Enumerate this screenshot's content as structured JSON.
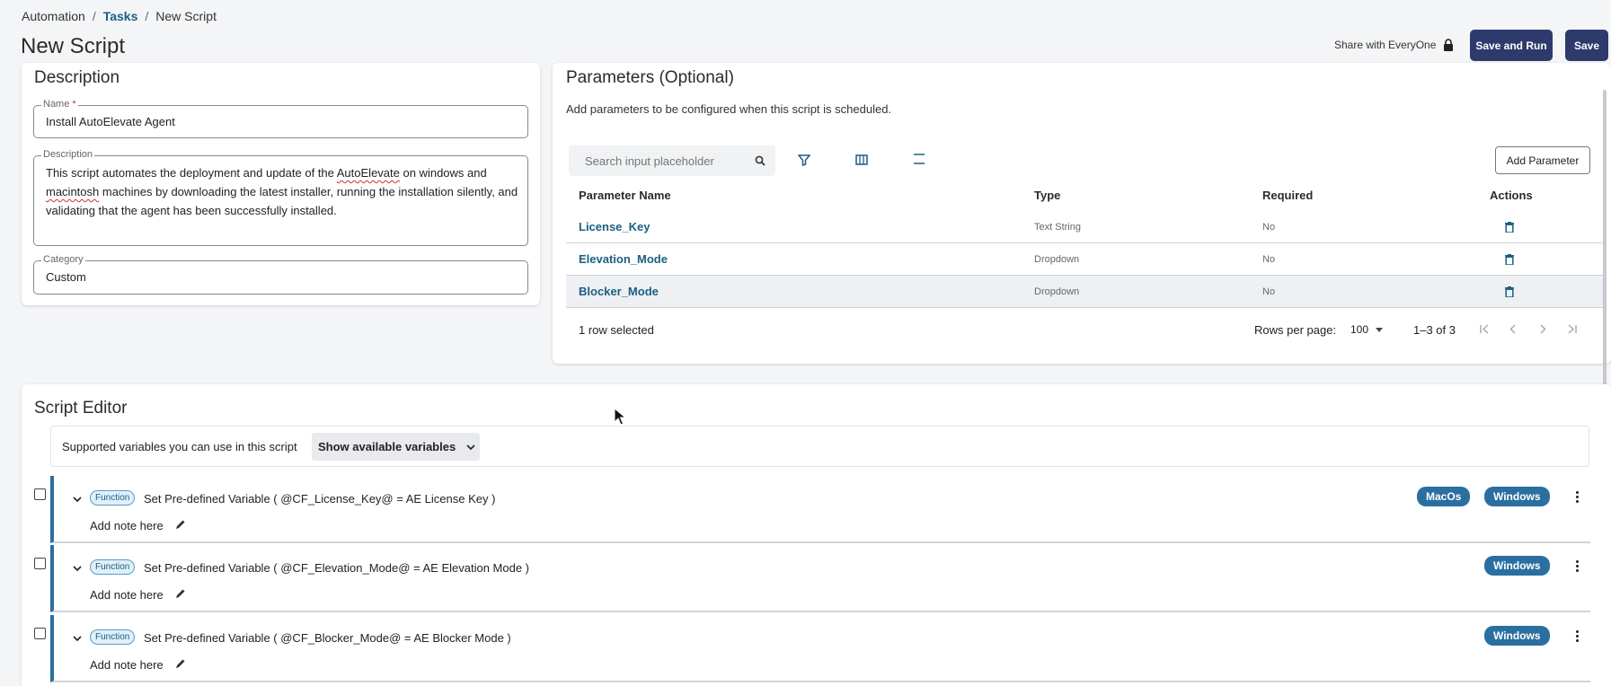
{
  "breadcrumb": {
    "root": "Automation",
    "tasks": "Tasks",
    "current": "New Script",
    "separator": "/"
  },
  "header": {
    "title": "New Script",
    "share_label": "Share with EveryOne",
    "save_and_run_label": "Save and Run",
    "save_label": "Save"
  },
  "description": {
    "title": "Description",
    "name_label": "Name",
    "name_required": "*",
    "name_value": "Install AutoElevate Agent",
    "desc_label": "Description",
    "desc_part1": "This script automates the deployment and update of the ",
    "desc_spell1": "AutoElevate",
    "desc_part2": " on windows and ",
    "desc_spell2": "macintosh",
    "desc_part3": " machines by downloading the latest installer, running the installation silently, and validating that the agent has been successfully installed.",
    "category_label": "Category",
    "category_value": "Custom"
  },
  "parameters": {
    "title": "Parameters (Optional)",
    "subtitle": "Add parameters to be configured when this script is scheduled.",
    "search_placeholder": "Search input placeholder",
    "add_button": "Add Parameter",
    "columns": [
      "Parameter Name",
      "Type",
      "Required",
      "Actions"
    ],
    "rows": [
      {
        "name": "License_Key",
        "type": "Text String",
        "required": "No"
      },
      {
        "name": "Elevation_Mode",
        "type": "Dropdown",
        "required": "No"
      },
      {
        "name": "Blocker_Mode",
        "type": "Dropdown",
        "required": "No"
      }
    ],
    "selected_text": "1 row selected",
    "rows_per_page_label": "Rows per page:",
    "rows_per_page_value": "100",
    "range": "1–3 of 3"
  },
  "editor": {
    "title": "Script Editor",
    "vars_label": "Supported variables you can use in this script",
    "vars_button": "Show available variables",
    "steps": [
      {
        "tag": "Function",
        "text": "Set Pre-defined Variable ( @CF_License_Key@ = AE License Key )",
        "note": "Add note here",
        "pills": [
          "MacOs",
          "Windows"
        ]
      },
      {
        "tag": "Function",
        "text": "Set Pre-defined Variable ( @CF_Elevation_Mode@ = AE Elevation Mode )",
        "note": "Add note here",
        "pills": [
          "Windows"
        ]
      },
      {
        "tag": "Function",
        "text": "Set Pre-defined Variable ( @CF_Blocker_Mode@ = AE Blocker Mode )",
        "note": "Add note here",
        "pills": [
          "Windows"
        ]
      }
    ]
  },
  "colors": {
    "primary": "#2d3a6b",
    "link": "#1a5f82",
    "pill": "#2a6fa0",
    "selected_row": "#eef0f3"
  },
  "icons": [
    "lock-icon",
    "search-icon",
    "filter-icon",
    "columns-icon",
    "density-icon",
    "trash-icon",
    "chevron-down-icon",
    "pencil-icon",
    "kebab-icon",
    "cursor-icon",
    "first-page-icon",
    "prev-page-icon",
    "next-page-icon",
    "last-page-icon"
  ]
}
